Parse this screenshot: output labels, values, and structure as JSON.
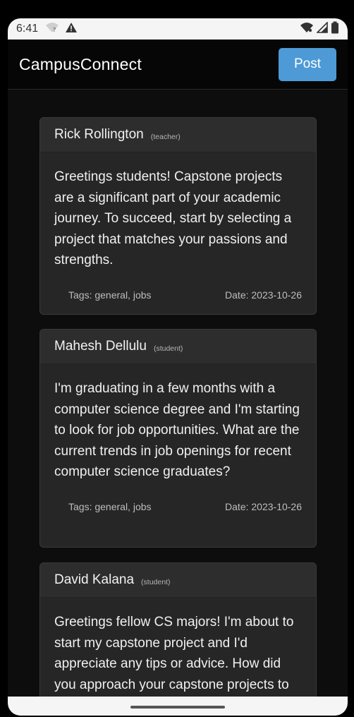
{
  "status_bar": {
    "time": "6:41",
    "left_icons": [
      "wifi-question-icon",
      "warning-icon"
    ],
    "right_icons": [
      "wifi-icon",
      "signal-icon",
      "battery-icon"
    ]
  },
  "app_bar": {
    "title": "CampusConnect",
    "post_label": "Post",
    "post_color": "#4d9ad6"
  },
  "posts": [
    {
      "author": "Rick Rollington",
      "role": "(teacher)",
      "text": "Greetings students! Capstone projects are a significant part of your academic journey. To succeed, start by selecting a project that matches your passions and strengths.",
      "tags": "Tags: general, jobs",
      "date": "Date: 2023-10-26"
    },
    {
      "author": "Mahesh Dellulu",
      "role": "(student)",
      "text": "I'm graduating in a few months with a computer science degree and I'm starting to look for job opportunities. What are the current trends in job openings for recent computer science graduates?",
      "tags": "Tags: general, jobs",
      "date": "Date: 2023-10-26"
    },
    {
      "author": "David Kalana",
      "role": "(student)",
      "text": "Greetings fellow CS majors! I'm about to start my capstone project and I'd appreciate any tips or advice. How did you approach your capstone projects to",
      "tags": "",
      "date": ""
    }
  ]
}
